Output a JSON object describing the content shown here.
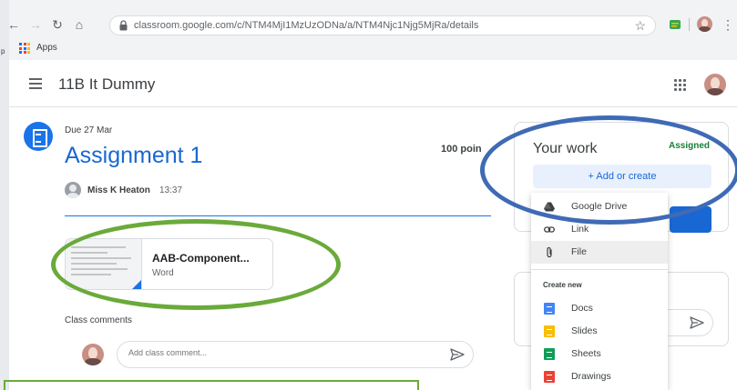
{
  "browser": {
    "url": "classroom.google.com/c/NTM4MjI1MzUzODNa/a/NTM4Njc1Njg5MjRa/details",
    "bookmark_apps": "Apps",
    "left_edge_fragment": "p"
  },
  "header": {
    "class_title": "11B It Dummy"
  },
  "assignment": {
    "due": "Due 27 Mar",
    "title": "Assignment 1",
    "points": "100 poin",
    "teacher": "Miss K Heaton",
    "time": "13:37",
    "attachment": {
      "name": "AAB-Component...",
      "type": "Word"
    },
    "class_comments_label": "Class comments",
    "comment_placeholder": "Add class comment..."
  },
  "your_work": {
    "title": "Your work",
    "status": "Assigned",
    "add_button": "+ Add or create"
  },
  "add_menu": {
    "items": [
      {
        "label": "Google Drive",
        "icon": "google-drive-icon"
      },
      {
        "label": "Link",
        "icon": "link-icon"
      },
      {
        "label": "File",
        "icon": "paperclip-icon"
      }
    ],
    "create_new_label": "Create new",
    "create_items": [
      {
        "label": "Docs",
        "icon": "docs-icon",
        "color": "#4285f4"
      },
      {
        "label": "Slides",
        "icon": "slides-icon",
        "color": "#fbbc04"
      },
      {
        "label": "Sheets",
        "icon": "sheets-icon",
        "color": "#0f9d58"
      },
      {
        "label": "Drawings",
        "icon": "drawings-icon",
        "color": "#ea4335"
      }
    ]
  },
  "colors": {
    "accent": "#1967d2",
    "status_green": "#188038",
    "annotation_green": "#6aaa3a",
    "annotation_blue": "#3f6ab5"
  }
}
